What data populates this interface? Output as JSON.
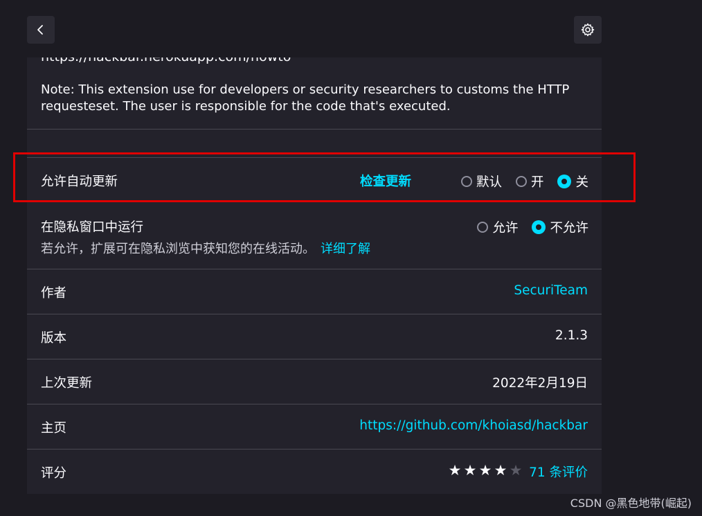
{
  "url_partial": "https://hackbar.herokuapp.com/howto",
  "note": "Note: This extension use for developers or security researchers to customs the HTTP requesteset. The user is responsible for the code that's executed.",
  "auto_update": {
    "label": "允许自动更新",
    "check_update": "检查更新",
    "options": [
      "默认",
      "开",
      "关"
    ],
    "selected": "关"
  },
  "private_window": {
    "label": "在隐私窗口中运行",
    "description": "若允许，扩展可在隐私浏览中获知您的在线活动。",
    "learn_more": "详细了解",
    "options": [
      "允许",
      "不允许"
    ],
    "selected": "不允许"
  },
  "details": {
    "author_label": "作者",
    "author_value": "SecuriTeam",
    "version_label": "版本",
    "version_value": "2.1.3",
    "last_updated_label": "上次更新",
    "last_updated_value": "2022年2月19日",
    "homepage_label": "主页",
    "homepage_value": "https://github.com/khoiasd/hackbar",
    "rating_label": "评分",
    "rating_stars": 4,
    "rating_max": 5,
    "review_count": "71 条评价"
  },
  "watermark": "CSDN @黑色地带(崛起)",
  "colors": {
    "background": "#1c1b22",
    "card": "#23222b",
    "accent": "#00ddff",
    "highlight_border": "#e00000"
  }
}
